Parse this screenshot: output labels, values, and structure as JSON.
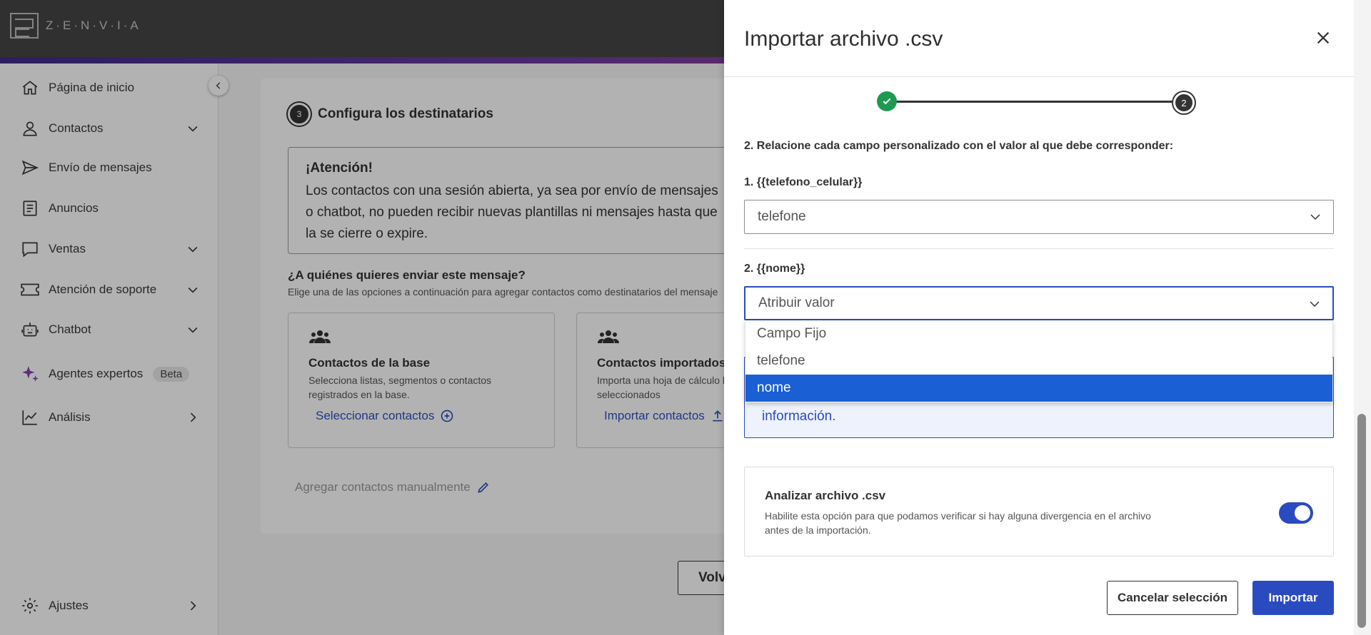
{
  "app": {
    "logo_text": "Z·E·N·V·I·A"
  },
  "sidebar": {
    "items": [
      {
        "label": "Página de inicio",
        "icon": "home-icon"
      },
      {
        "label": "Contactos",
        "icon": "user-icon"
      },
      {
        "label": "Envío de mensajes",
        "icon": "send-icon"
      },
      {
        "label": "Anuncios",
        "icon": "document-icon"
      },
      {
        "label": "Ventas",
        "icon": "chat-bubble-icon"
      },
      {
        "label": "Atención de soporte",
        "icon": "ticket-icon"
      },
      {
        "label": "Chatbot",
        "icon": "robot-icon"
      },
      {
        "label": "Agentes expertos",
        "icon": "sparkle-icon",
        "badge": "Beta"
      },
      {
        "label": "Análisis",
        "icon": "chart-icon"
      }
    ],
    "settings": {
      "label": "Ajustes",
      "icon": "gear-icon"
    }
  },
  "main": {
    "step_number": "3",
    "step_title": "Configura los destinatarios",
    "alert": {
      "title": "¡Atención!",
      "text": "Los contactos con una sesión abierta, ya sea por envío de mensajes o chatbot, no pueden recibir nuevas plantillas ni mensajes hasta que la se cierre o expire."
    },
    "question": "¿A quiénes quieres enviar este mensaje?",
    "question_sub": "Elige una de las opciones a continuación para agregar contactos como destinatarios del mensaje",
    "option_base": {
      "title": "Contactos de la base",
      "text": "Selecciona listas, segmentos o contactos registrados en la base.",
      "link": "Seleccionar contactos"
    },
    "option_imported": {
      "title": "Contactos importados",
      "text": "Importa una hoja de cálculo los contactos seleccionados",
      "link": "Importar contactos"
    },
    "manual_link": "Agregar contactos manualmente",
    "back_button": "Volver"
  },
  "drawer": {
    "title": "Importar archivo .csv",
    "stepper": {
      "current": "2"
    },
    "instruction": "2. Relacione cada campo personalizado con el valor al que debe corresponder:",
    "field1": {
      "label": "1. {{telefono_celular}}",
      "value": "telefone"
    },
    "field2": {
      "label": "2. {{nome}}",
      "placeholder": "Atribuir valor"
    },
    "dropdown_options": [
      "Campo Fijo",
      "telefone",
      "nome"
    ],
    "dropdown_selected_index": 2,
    "info_link": "información.",
    "analyze": {
      "title": "Analizar archivo .csv",
      "text": "Habilite esta opción para que podamos verificar si hay alguna divergencia en el archivo antes de la importación.",
      "enabled": true
    },
    "cancel_button": "Cancelar selección",
    "import_button": "Importar"
  },
  "colors": {
    "primary": "#2a4bc0",
    "selected_option": "#1a5fd3",
    "success": "#1e9a50",
    "topbar": "#454545"
  }
}
